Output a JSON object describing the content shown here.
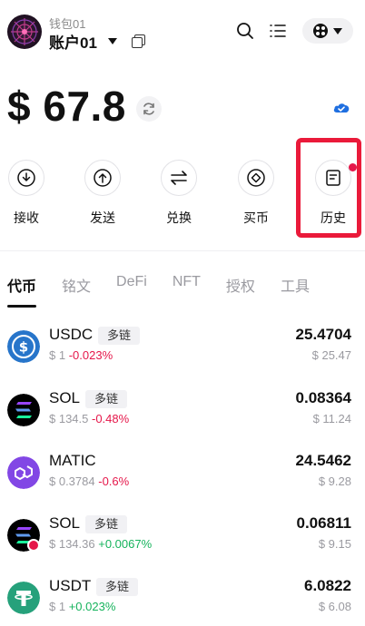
{
  "header": {
    "wallet_name": "钱包01",
    "account_name": "账户01",
    "icons": [
      "avatar",
      "caret-down-icon",
      "copy-icon",
      "search-icon",
      "menu-icon",
      "network-icon"
    ]
  },
  "balance": {
    "text": "$ 67.8"
  },
  "actions": [
    {
      "label": "接收",
      "icon": "receive-icon"
    },
    {
      "label": "发送",
      "icon": "send-icon"
    },
    {
      "label": "兑换",
      "icon": "swap-icon"
    },
    {
      "label": "买币",
      "icon": "buy-icon"
    },
    {
      "label": "历史",
      "icon": "history-icon"
    }
  ],
  "tabs": [
    {
      "label": "代币",
      "active": true
    },
    {
      "label": "铭文",
      "active": false
    },
    {
      "label": "DeFi",
      "active": false
    },
    {
      "label": "NFT",
      "active": false
    },
    {
      "label": "授权",
      "active": false
    },
    {
      "label": "工具",
      "active": false
    }
  ],
  "tokens": [
    {
      "symbol": "USDC",
      "tag": "多链",
      "price": "$ 1",
      "change": "-0.023%",
      "change_dir": "neg",
      "amount": "25.4704",
      "value": "$ 25.47",
      "icon": "usdc-icon",
      "color": "#2775ca"
    },
    {
      "symbol": "SOL",
      "tag": "多链",
      "price": "$ 134.5",
      "change": "-0.48%",
      "change_dir": "neg",
      "amount": "0.08364",
      "value": "$ 11.24",
      "icon": "sol-icon",
      "color": "#000000"
    },
    {
      "symbol": "MATIC",
      "tag": "",
      "price": "$ 0.3784",
      "change": "-0.6%",
      "change_dir": "neg",
      "amount": "24.5462",
      "value": "$ 9.28",
      "icon": "matic-icon",
      "color": "#8247e5"
    },
    {
      "symbol": "SOL",
      "tag": "多链",
      "price": "$ 134.36",
      "change": "+0.0067%",
      "change_dir": "pos",
      "amount": "0.06811",
      "value": "$ 9.15",
      "icon": "sol-icon",
      "color": "#000000"
    },
    {
      "symbol": "USDT",
      "tag": "多链",
      "price": "$ 1",
      "change": "+0.023%",
      "change_dir": "pos",
      "amount": "6.0822",
      "value": "$ 6.08",
      "icon": "usdt-icon",
      "color": "#26a17b"
    }
  ],
  "colors": {
    "highlight": "#ea1a3a",
    "negative": "#e5174a",
    "positive": "#16b35c"
  }
}
